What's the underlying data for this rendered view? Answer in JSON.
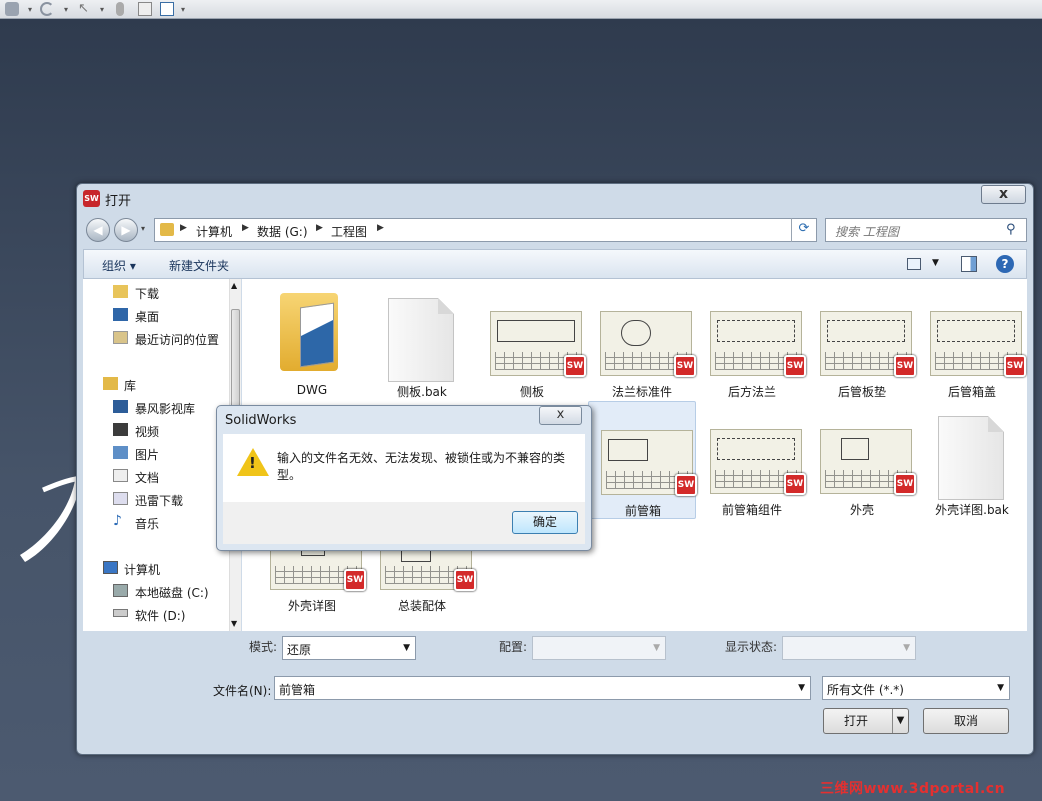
{
  "dialog": {
    "title": "打开",
    "close_glyph": "x",
    "back_glyph": "◀",
    "forward_glyph": "▶",
    "icon_text": "SW"
  },
  "breadcrumb": [
    "计算机",
    "数据 (G:)",
    "工程图"
  ],
  "search": {
    "placeholder": "搜索 工程图"
  },
  "toolbar": {
    "organize": "组织 ▾",
    "new_folder": "新建文件夹",
    "help": "?"
  },
  "nav_pane": {
    "items": [
      {
        "label": "下载",
        "icon": "download-folder-icon"
      },
      {
        "label": "桌面",
        "icon": "desktop-icon"
      },
      {
        "label": "最近访问的位置",
        "icon": "recent-places-icon"
      },
      {
        "label": "库",
        "icon": "libraries-icon"
      },
      {
        "label": "暴风影视库",
        "icon": "video-library-icon"
      },
      {
        "label": "视频",
        "icon": "video-icon"
      },
      {
        "label": "图片",
        "icon": "pictures-icon"
      },
      {
        "label": "文档",
        "icon": "documents-icon"
      },
      {
        "label": "迅雷下载",
        "icon": "xunlei-download-icon"
      },
      {
        "label": "音乐",
        "icon": "music-icon"
      },
      {
        "label": "计算机",
        "icon": "computer-icon"
      },
      {
        "label": "本地磁盘 (C:)",
        "icon": "drive-c-icon"
      },
      {
        "label": "软件 (D:)",
        "icon": "drive-d-icon"
      }
    ]
  },
  "files": [
    {
      "name": "DWG",
      "kind": "folder"
    },
    {
      "name": "侧板.bak",
      "kind": "bak"
    },
    {
      "name": "侧板",
      "kind": "drawing"
    },
    {
      "name": "法兰标准件",
      "kind": "drawing"
    },
    {
      "name": "后方法兰",
      "kind": "drawing"
    },
    {
      "name": "后管板垫",
      "kind": "drawing"
    },
    {
      "name": "后管箱盖",
      "kind": "drawing"
    },
    {
      "name": "前管箱",
      "kind": "drawing",
      "selected": true
    },
    {
      "name": "前管箱组件",
      "kind": "drawing"
    },
    {
      "name": "外壳",
      "kind": "drawing"
    },
    {
      "name": "外壳详图.bak",
      "kind": "bak"
    },
    {
      "name": "外壳详图",
      "kind": "drawing"
    },
    {
      "name": "总装配体",
      "kind": "drawing"
    }
  ],
  "sw_badge": "SW",
  "options": {
    "mode_label": "模式:",
    "mode_value": "还原",
    "config_label": "配置:",
    "display_label": "显示状态:"
  },
  "filename": {
    "label": "文件名(N):",
    "value": "前管箱",
    "filter": "所有文件 (*.*)"
  },
  "buttons": {
    "open": "打开",
    "cancel": "取消"
  },
  "message_box": {
    "title": "SolidWorks",
    "text": "输入的文件名无效、无法发现、被锁住或为不兼容的类型。",
    "ok": "确定",
    "close_glyph": "x",
    "icon": "warning-icon"
  },
  "watermark": "三维网www.3dportal.cn"
}
